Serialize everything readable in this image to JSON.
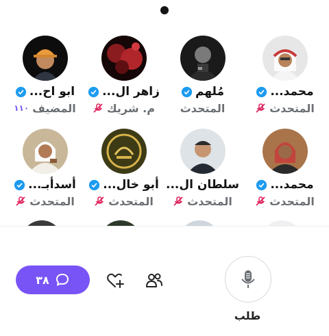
{
  "speakers_row1": [
    {
      "name": "محمد...",
      "role": "المتحدث",
      "verified": true,
      "muted": true,
      "avatar": "portrait-man-ghutra"
    },
    {
      "name": "مُلهم",
      "role": "المتحدث",
      "verified": true,
      "muted": false,
      "avatar": "portrait-man-dark"
    },
    {
      "name": "زاهر ال...",
      "role": "م. شريك",
      "verified": true,
      "muted": true,
      "avatar": "red-foliage-photo"
    },
    {
      "name": "ابو اح...",
      "role": "المضيف",
      "verified": true,
      "muted": false,
      "host_indicator": "١١٠",
      "avatar": "portrait-man-cap"
    }
  ],
  "speakers_row2": [
    {
      "name": "محمد...",
      "role": "المتحدث",
      "verified": true,
      "muted": true,
      "avatar": "portrait-man-red-ghutra"
    },
    {
      "name": "سلطان ال...",
      "role": "المتحدث",
      "verified": false,
      "muted": true,
      "avatar": "portrait-man-hoodie"
    },
    {
      "name": "أبو خال...",
      "role": "المتحدث",
      "verified": true,
      "muted": true,
      "avatar": "calligraphy-emblem"
    },
    {
      "name": "أسدأبـ...",
      "role": "المتحدث",
      "verified": true,
      "muted": true,
      "avatar": "portrait-man-white"
    }
  ],
  "bottom_bar": {
    "chat_count": "٣٨",
    "request_label": "طلب"
  },
  "colors": {
    "accent": "#7853f5",
    "verified": "#1d9bf0",
    "mic_muted": "#e0245e",
    "role_text": "#6b6f73"
  },
  "icons": {
    "chat": "chat-bubble-icon",
    "react": "heart-plus-icon",
    "people": "people-icon",
    "mic": "microphone-icon"
  }
}
